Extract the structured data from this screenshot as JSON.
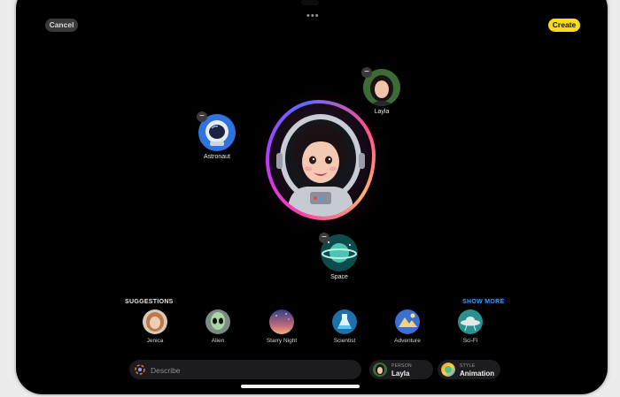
{
  "toolbar": {
    "cancel_label": "Cancel",
    "create_label": "Create",
    "more_label": "•••"
  },
  "canvas": {
    "bubbles": [
      {
        "label": "Layla",
        "icon": "person-photo-layla"
      },
      {
        "label": "Astronaut",
        "icon": "astronaut-helmet-icon"
      },
      {
        "label": "Space",
        "icon": "planet-icon"
      }
    ],
    "remove_glyph": "−"
  },
  "suggestions": {
    "title": "SUGGESTIONS",
    "show_more": "SHOW MORE",
    "items": [
      {
        "label": "Jenica",
        "icon": "person-photo-jenica"
      },
      {
        "label": "Alien",
        "icon": "alien-icon"
      },
      {
        "label": "Starry Night",
        "icon": "starry-night-icon"
      },
      {
        "label": "Scientist",
        "icon": "flask-icon"
      },
      {
        "label": "Adventure",
        "icon": "adventure-map-icon"
      },
      {
        "label": "Sci-Fi",
        "icon": "ufo-icon"
      }
    ]
  },
  "bottom_bar": {
    "describe_placeholder": "Describe",
    "person": {
      "key": "PERSON",
      "value": "Layla"
    },
    "style": {
      "key": "STYLE",
      "value": "Animation"
    }
  },
  "colors": {
    "accent_yellow": "#f7dd16",
    "show_more_blue": "#3d9bff"
  }
}
